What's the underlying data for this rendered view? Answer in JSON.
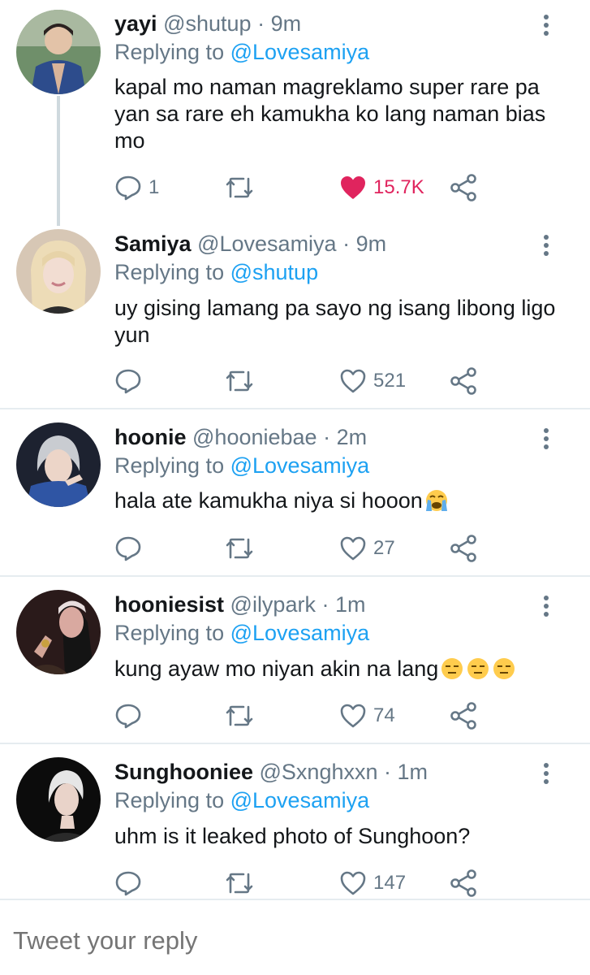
{
  "tweets": [
    {
      "name": "yayi",
      "handle": "@shutup",
      "separator": "·",
      "time": "9m",
      "replying_prefix": "Replying to",
      "replying_to": "@Lovesamiya",
      "text": "kapal mo naman magreklamo super rare pa yan sa rare eh kamukha ko lang naman bias mo",
      "reply_count": "1",
      "retweet_count": "",
      "like_count": "15.7K",
      "liked": true
    },
    {
      "name": "Samiya",
      "handle": "@Lovesamiya",
      "separator": "·",
      "time": "9m",
      "replying_prefix": "Replying to",
      "replying_to": "@shutup",
      "text": "uy gising lamang pa sayo ng isang libong ligo yun",
      "reply_count": "",
      "retweet_count": "",
      "like_count": "521",
      "liked": false
    },
    {
      "name": "hoonie",
      "handle": "@hooniebae",
      "separator": "·",
      "time": "2m",
      "replying_prefix": "Replying to",
      "replying_to": "@Lovesamiya",
      "text": "hala ate kamukha niya si hooon",
      "emojis": [
        "loudly-crying-face"
      ],
      "reply_count": "",
      "retweet_count": "",
      "like_count": "27",
      "liked": false
    },
    {
      "name": "hooniesist",
      "handle": "@ilypark",
      "separator": "·",
      "time": "1m",
      "replying_prefix": "Replying to",
      "replying_to": "@Lovesamiya",
      "text": "kung ayaw mo niyan akin na lang",
      "emojis": [
        "expressionless-face",
        "expressionless-face",
        "expressionless-face"
      ],
      "reply_count": "",
      "retweet_count": "",
      "like_count": "74",
      "liked": false
    },
    {
      "name": "Sunghooniee",
      "handle": "@Sxnghxxn",
      "separator": "·",
      "time": "1m",
      "replying_prefix": "Replying to",
      "replying_to": "@Lovesamiya",
      "text": "uhm is it leaked photo of Sunghoon?",
      "reply_count": "",
      "retweet_count": "",
      "like_count": "147",
      "liked": false
    }
  ],
  "compose": {
    "placeholder": "Tweet your reply"
  },
  "colors": {
    "link": "#1da1f2",
    "secondary_text": "#657786",
    "like_active": "#e0245e",
    "divider": "#e6ecf0"
  },
  "icons": [
    "reply-icon",
    "retweet-icon",
    "like-icon",
    "share-icon",
    "more-options-icon"
  ]
}
